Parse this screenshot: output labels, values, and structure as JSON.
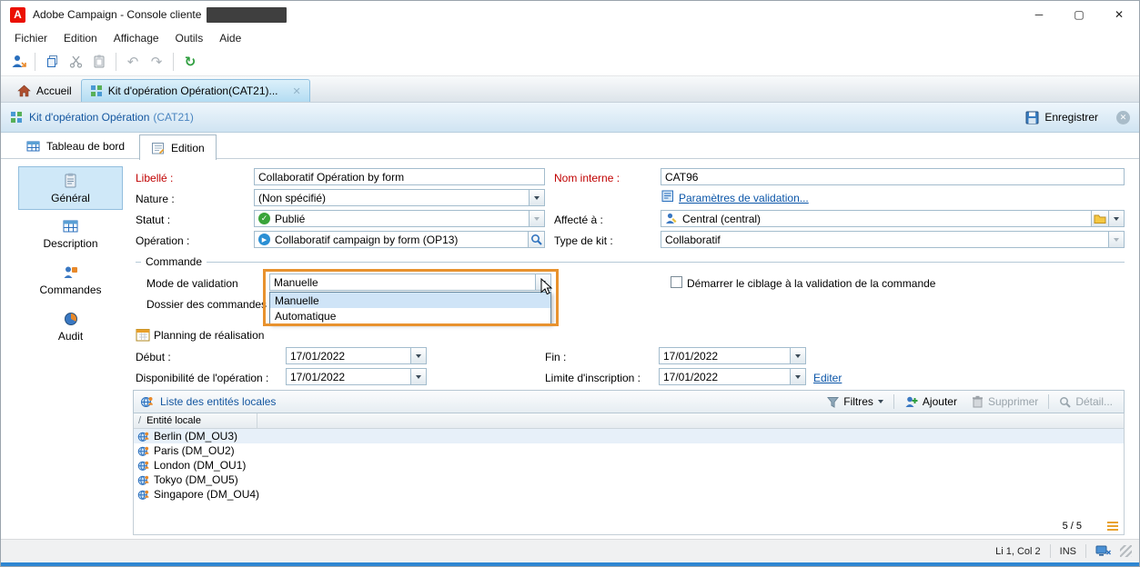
{
  "window": {
    "title": "Adobe Campaign - Console cliente",
    "minimize": "─",
    "maximize": "▢",
    "close": "✕"
  },
  "menubar": {
    "items": [
      "Fichier",
      "Edition",
      "Affichage",
      "Outils",
      "Aide"
    ]
  },
  "glyphs": {
    "undo": "↶",
    "redo": "↷",
    "refresh": "↻",
    "tab_close": "✕",
    "crumb_close": "✕",
    "check": "✓",
    "play": "▶"
  },
  "tabs": {
    "home": "Accueil",
    "document": "Kit d'opération  Opération(CAT21)..."
  },
  "header": {
    "title": "Kit d'opération Opération",
    "code": "(CAT21)",
    "save": "Enregistrer"
  },
  "subtabs": {
    "dashboard": "Tableau de bord",
    "edition": "Edition"
  },
  "sidebar": {
    "items": [
      {
        "label": "Général"
      },
      {
        "label": "Description"
      },
      {
        "label": "Commandes"
      },
      {
        "label": "Audit"
      }
    ]
  },
  "form": {
    "libelle_label": "Libellé :",
    "libelle_value": "Collaboratif Opération by form",
    "nom_interne_label": "Nom interne :",
    "nom_interne_value": "CAT96",
    "nature_label": "Nature :",
    "nature_value": "(Non spécifié)",
    "validation_link": "Paramètres de validation...",
    "statut_label": "Statut :",
    "statut_value": "Publié",
    "affecte_label": "Affecté à :",
    "affecte_value": "Central (central)",
    "operation_label": "Opération :",
    "operation_value": "Collaboratif campaign by form (OP13)",
    "type_kit_label": "Type de kit :",
    "type_kit_value": "Collaboratif"
  },
  "commande": {
    "legend": "Commande",
    "mode_label": "Mode de validation",
    "mode_value": "Manuelle",
    "mode_options": [
      "Manuelle",
      "Automatique"
    ],
    "dossier_label": "Dossier des commandes",
    "checkbox_label": "Démarrer le ciblage à la validation de la commande"
  },
  "planning": {
    "title": "Planning de réalisation",
    "debut_label": "Début :",
    "debut_value": "17/01/2022",
    "fin_label": "Fin :",
    "fin_value": "17/01/2022",
    "dispo_label": "Disponibilité de l'opération :",
    "dispo_value": "17/01/2022",
    "limite_label": "Limite d'inscription :",
    "limite_value": "17/01/2022",
    "editer": "Editer"
  },
  "entities": {
    "title": "Liste des entités locales",
    "filtres": "Filtres",
    "ajouter": "Ajouter",
    "supprimer": "Supprimer",
    "detail": "Détail...",
    "sort_glyph": "/",
    "column": "Entité locale",
    "rows": [
      {
        "label": "Berlin (DM_OU3)"
      },
      {
        "label": "Paris (DM_OU2)"
      },
      {
        "label": "London (DM_OU1)"
      },
      {
        "label": "Tokyo (DM_OU5)"
      },
      {
        "label": "Singapore (DM_OU4)"
      }
    ],
    "count": "5 / 5"
  },
  "statusbar": {
    "position": "Li 1, Col 2",
    "mode": "INS"
  },
  "colors": {
    "annotation_orange": "#e8922e",
    "label_red": "#c00000",
    "link_blue": "#0a55a8",
    "adobe_red": "#eb1000",
    "status_green": "#3aa43a",
    "selected_tab_blue": "#b3dcf2",
    "bottom_strip_blue": "#2e86d2"
  }
}
